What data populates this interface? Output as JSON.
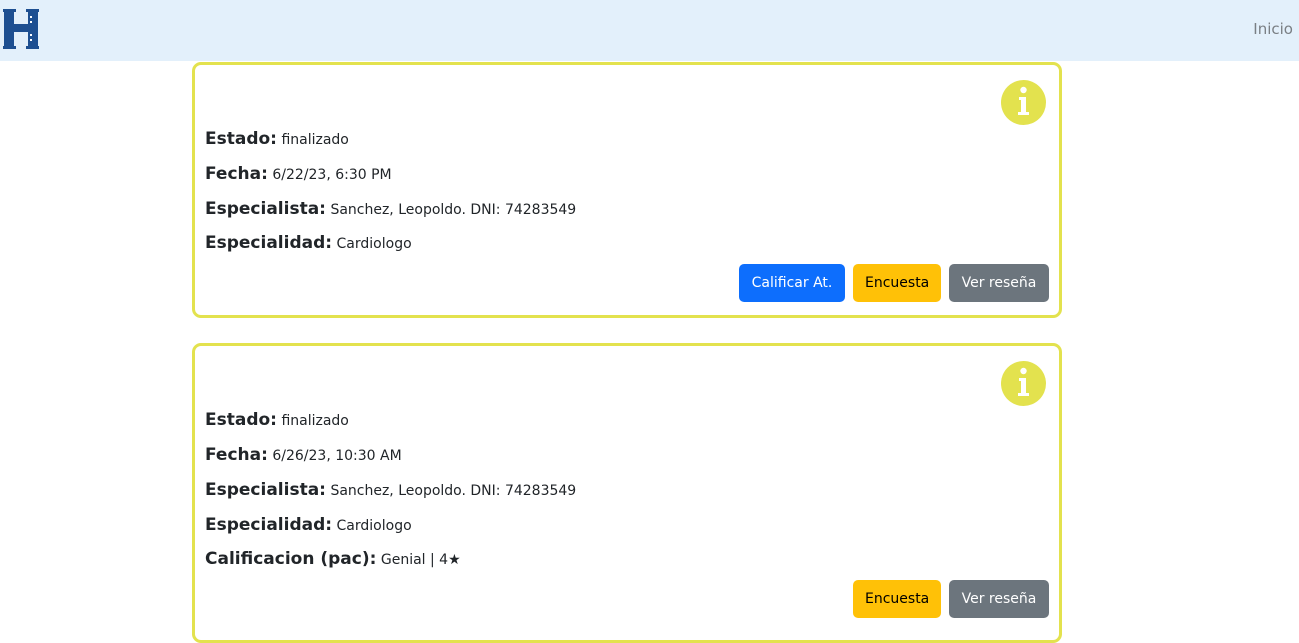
{
  "navbar": {
    "logo_letter": "H",
    "inicio_label": "Inicio"
  },
  "labels": {
    "estado": "Estado:",
    "fecha": "Fecha:",
    "especialista": "Especialista:",
    "especialidad": "Especialidad:",
    "calificacion": "Calificacion (pac):"
  },
  "cards": [
    {
      "estado": "finalizado",
      "fecha": "6/22/23, 6:30 PM",
      "especialista": "Sanchez, Leopoldo. DNI: 74283549",
      "especialidad": "Cardiologo",
      "buttons": {
        "calificar": "Calificar At.",
        "encuesta": "Encuesta",
        "resena": "Ver reseña"
      }
    },
    {
      "estado": "finalizado",
      "fecha": "6/26/23, 10:30 AM",
      "especialista": "Sanchez, Leopoldo. DNI: 74283549",
      "especialidad": "Cardiologo",
      "calificacion": "Genial | 4★",
      "buttons": {
        "encuesta": "Encuesta",
        "resena": "Ver reseña"
      }
    }
  ],
  "colors": {
    "navbar_bg": "#e3f0fb",
    "card_border": "#e3e24e",
    "info_icon_bg": "#e3e24e",
    "primary": "#0d6efd",
    "warning": "#ffc107",
    "secondary": "#6c757d",
    "logo": "#1d4f91"
  },
  "icons": [
    "hospital-logo-icon",
    "info-icon"
  ]
}
